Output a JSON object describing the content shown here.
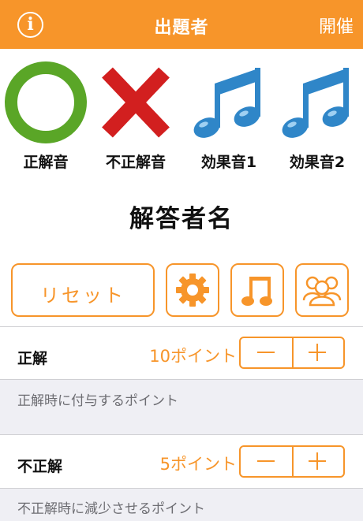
{
  "navbar": {
    "info_icon": "i",
    "title": "出題者",
    "right_button": "開催"
  },
  "sounds": [
    {
      "label": "正解音",
      "icon": "circle-icon",
      "color": "#5aa627"
    },
    {
      "label": "不正解音",
      "icon": "cross-icon",
      "color": "#d21f1f"
    },
    {
      "label": "効果音1",
      "icon": "music-note-icon",
      "color": "#2f86c8"
    },
    {
      "label": "効果音2",
      "icon": "music-note-icon",
      "color": "#2f86c8"
    }
  ],
  "answerer_name": "解答者名",
  "toolbar": {
    "reset_label": "リセット",
    "icons": [
      "gear-icon",
      "music-note-icon",
      "group-icon"
    ]
  },
  "correct": {
    "label": "正解",
    "value": "10ポイント",
    "footer": "正解時に付与するポイント"
  },
  "incorrect": {
    "label": "不正解",
    "value": "5ポイント",
    "footer": "不正解時に減少させるポイント"
  },
  "colors": {
    "accent": "#f7952a",
    "grouped_background": "#efeff4"
  }
}
